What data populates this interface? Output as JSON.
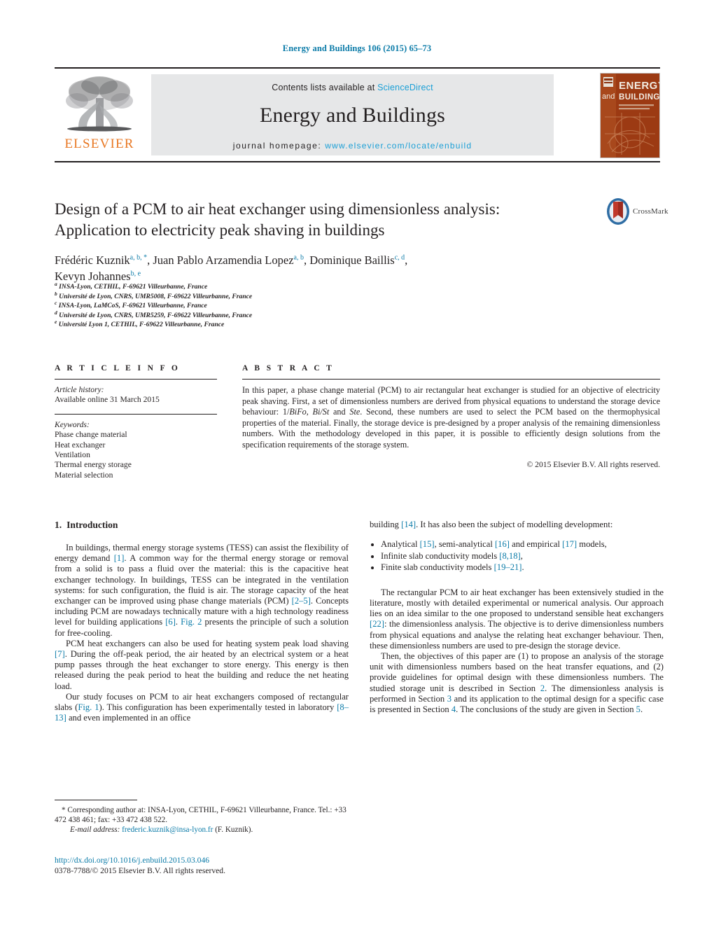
{
  "running_head": "Energy and Buildings 106 (2015) 65–73",
  "masthead": {
    "publisher_logo_text": "ELSEVIER",
    "contents_prefix": "Contents lists available at",
    "contents_link": "ScienceDirect",
    "journal_title": "Energy and Buildings",
    "homepage_prefix": "journal homepage:",
    "homepage_url": "www.elsevier.com/locate/enbuild",
    "cover_line1": "ENERGY",
    "cover_line2": "and",
    "cover_line3": "BUILDINGS"
  },
  "crossmark": {
    "label": "CrossMark"
  },
  "article": {
    "title_line1": "Design of a PCM to air heat exchanger using dimensionless analysis:",
    "title_line2": "Application to electricity peak shaving in buildings",
    "authors": [
      {
        "name": "Frédéric Kuznik",
        "marks": "a, b, *"
      },
      {
        "name": "Juan Pablo Arzamendia Lopez",
        "marks": "a, b"
      },
      {
        "name": "Dominique Baillis",
        "marks": "c, d"
      },
      {
        "name": "Kevyn Johannes",
        "marks": "b, e"
      }
    ],
    "affiliations": [
      {
        "mark": "a",
        "text": "INSA-Lyon, CETHIL, F-69621 Villeurbanne, France"
      },
      {
        "mark": "b",
        "text": "Université de Lyon, CNRS, UMR5008, F-69622 Villeurbanne, France"
      },
      {
        "mark": "c",
        "text": "INSA-Lyon, LaMCoS, F-69621 Villeurbanne, France"
      },
      {
        "mark": "d",
        "text": "Université de Lyon, CNRS, UMR5259, F-69622 Villeurbanne, France"
      },
      {
        "mark": "e",
        "text": "Université Lyon 1, CETHIL, F-69622 Villeurbanne, France"
      }
    ]
  },
  "article_info": {
    "heading": "A R T I C L E    I N F O",
    "history_label": "Article history:",
    "history_value": "Available online 31 March 2015",
    "keywords_label": "Keywords:",
    "keywords": [
      "Phase change material",
      "Heat exchanger",
      "Ventilation",
      "Thermal energy storage",
      "Material selection"
    ]
  },
  "abstract": {
    "heading": "A B S T R A C T",
    "part1": "In this paper, a phase change material (PCM) to air rectangular heat exchanger is studied for an objective of electricity peak shaving. First, a set of dimensionless numbers are derived from physical equations to understand the storage device behaviour: 1/",
    "sym1": "BiFo",
    "part2": ", ",
    "sym2": "Bi/St",
    "part3": " and ",
    "sym3": "Ste",
    "part4": ". Second, these numbers are used to select the PCM based on the thermophysical properties of the material. Finally, the storage device is pre-designed by a proper analysis of the remaining dimensionless numbers. With the methodology developed in this paper, it is possible to efficiently design solutions from the specification requirements of the storage system.",
    "copyright": "© 2015 Elsevier B.V. All rights reserved."
  },
  "body": {
    "section1_number": "1.",
    "section1_title": "Introduction",
    "left_paragraphs": [
      "In buildings, thermal energy storage systems (TESS) can assist the flexibility of energy demand [1]. A common way for the thermal energy storage or removal from a solid is to pass a fluid over the material: this is the capacitive heat exchanger technology. In buildings, TESS can be integrated in the ventilation systems: for such configuration, the fluid is air. The storage capacity of the heat exchanger can be improved using phase change materials (PCM) [2–5]. Concepts including PCM are nowadays technically mature with a high technology readiness level for building applications [6]. Fig. 2 presents the principle of such a solution for free-cooling.",
      "PCM heat exchangers can also be used for heating system peak load shaving [7]. During the off-peak period, the air heated by an electrical system or a heat pump passes through the heat exchanger to store energy. This energy is then released during the peak period to heat the building and reduce the net heating load.",
      "Our study focuses on PCM to air heat exchangers composed of rectangular slabs (Fig. 1). This configuration has been experimentally tested in laboratory [8–13] and even implemented in an office"
    ],
    "right_intro": "building [14]. It has also been the subject of modelling development:",
    "bullets": [
      "Analytical [15], semi-analytical [16] and empirical [17] models,",
      "Infinite slab conductivity models [8,18],",
      "Finite slab conductivity models [19–21]."
    ],
    "right_paragraphs": [
      "The rectangular PCM to air heat exchanger has been extensively studied in the literature, mostly with detailed experimental or numerical analysis. Our approach lies on an idea similar to the one proposed to understand sensible heat exchangers [22]: the dimensionless analysis. The objective is to derive dimensionless numbers from physical equations and analyse the relating heat exchanger behaviour. Then, these dimensionless numbers are used to pre-design the storage device.",
      "Then, the objectives of this paper are (1) to propose an analysis of the storage unit with dimensionless numbers based on the heat transfer equations, and (2) provide guidelines for optimal design with these dimensionless numbers. The studied storage unit is described in Section 2. The dimensionless analysis is performed in Section 3 and its application to the optimal design for a specific case is presented in Section 4. The conclusions of the study are given in Section 5."
    ]
  },
  "footnote": {
    "star": "*",
    "corresponding": "Corresponding author at: INSA-Lyon, CETHIL, F-69621 Villeurbanne, France. Tel.: +33 472 438 461; fax: +33 472 438 522.",
    "email_label": "E-mail address:",
    "email": "frederic.kuznik@insa-lyon.fr",
    "email_suffix": "(F. Kuznik)."
  },
  "doi_block": {
    "doi_url": "http://dx.doi.org/10.1016/j.enbuild.2015.03.046",
    "issn_line": "0378-7788/© 2015 Elsevier B.V. All rights reserved."
  },
  "colors": {
    "link": "#0b7ba8",
    "sciencedirect": "#1a9fd6",
    "elsevier_orange": "#e87722",
    "masthead_grey": "#e6e7e8",
    "cover_orange": "#9c3a13",
    "text": "#231f20"
  }
}
